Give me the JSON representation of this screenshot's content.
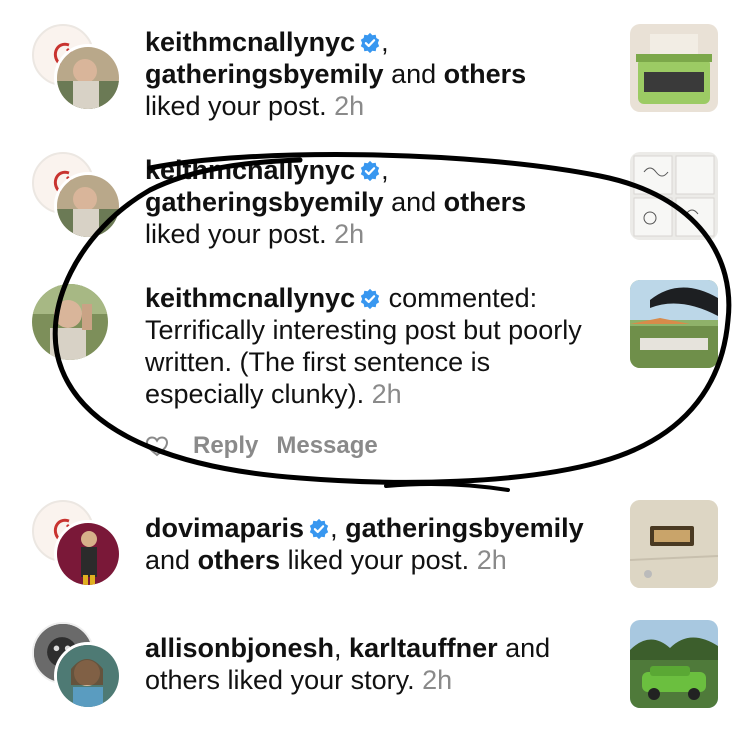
{
  "notifications": [
    {
      "user": "keithmcnallynyc",
      "sep": ",",
      "user2": "gatheringsbyemily",
      "joiner": " and ",
      "others": "others",
      "action": " liked your post. ",
      "time": "2h"
    },
    {
      "user": "keithmcnallynyc",
      "sep": ",",
      "user2": "gatheringsbyemily",
      "joiner": " and ",
      "others": "others",
      "action": " liked your post. ",
      "time": "2h"
    },
    {
      "user": "keithmcnallynyc",
      "action": " commented:",
      "comment": "Terrifically interesting post but poorly written. (The first sentence is especially clunky). ",
      "time": "2h",
      "reply_label": "Reply",
      "message_label": "Message"
    },
    {
      "user": "dovimaparis",
      "sep": ", ",
      "user2": "gatheringsbyemily",
      "joiner": " and ",
      "others": "others",
      "action": " liked your post. ",
      "time": "2h"
    },
    {
      "user": "allisonbjonesh",
      "sep": ", ",
      "user2": "karltauffner",
      "joiner": " and others liked your story. ",
      "time": "2h"
    }
  ],
  "icons": {
    "verified": "verified-badge-icon",
    "heart": "heart-outline-icon"
  },
  "colors": {
    "verified_blue": "#3897f0",
    "timestamp_gray": "#8a8a8a",
    "annotation_ink": "#000000"
  }
}
